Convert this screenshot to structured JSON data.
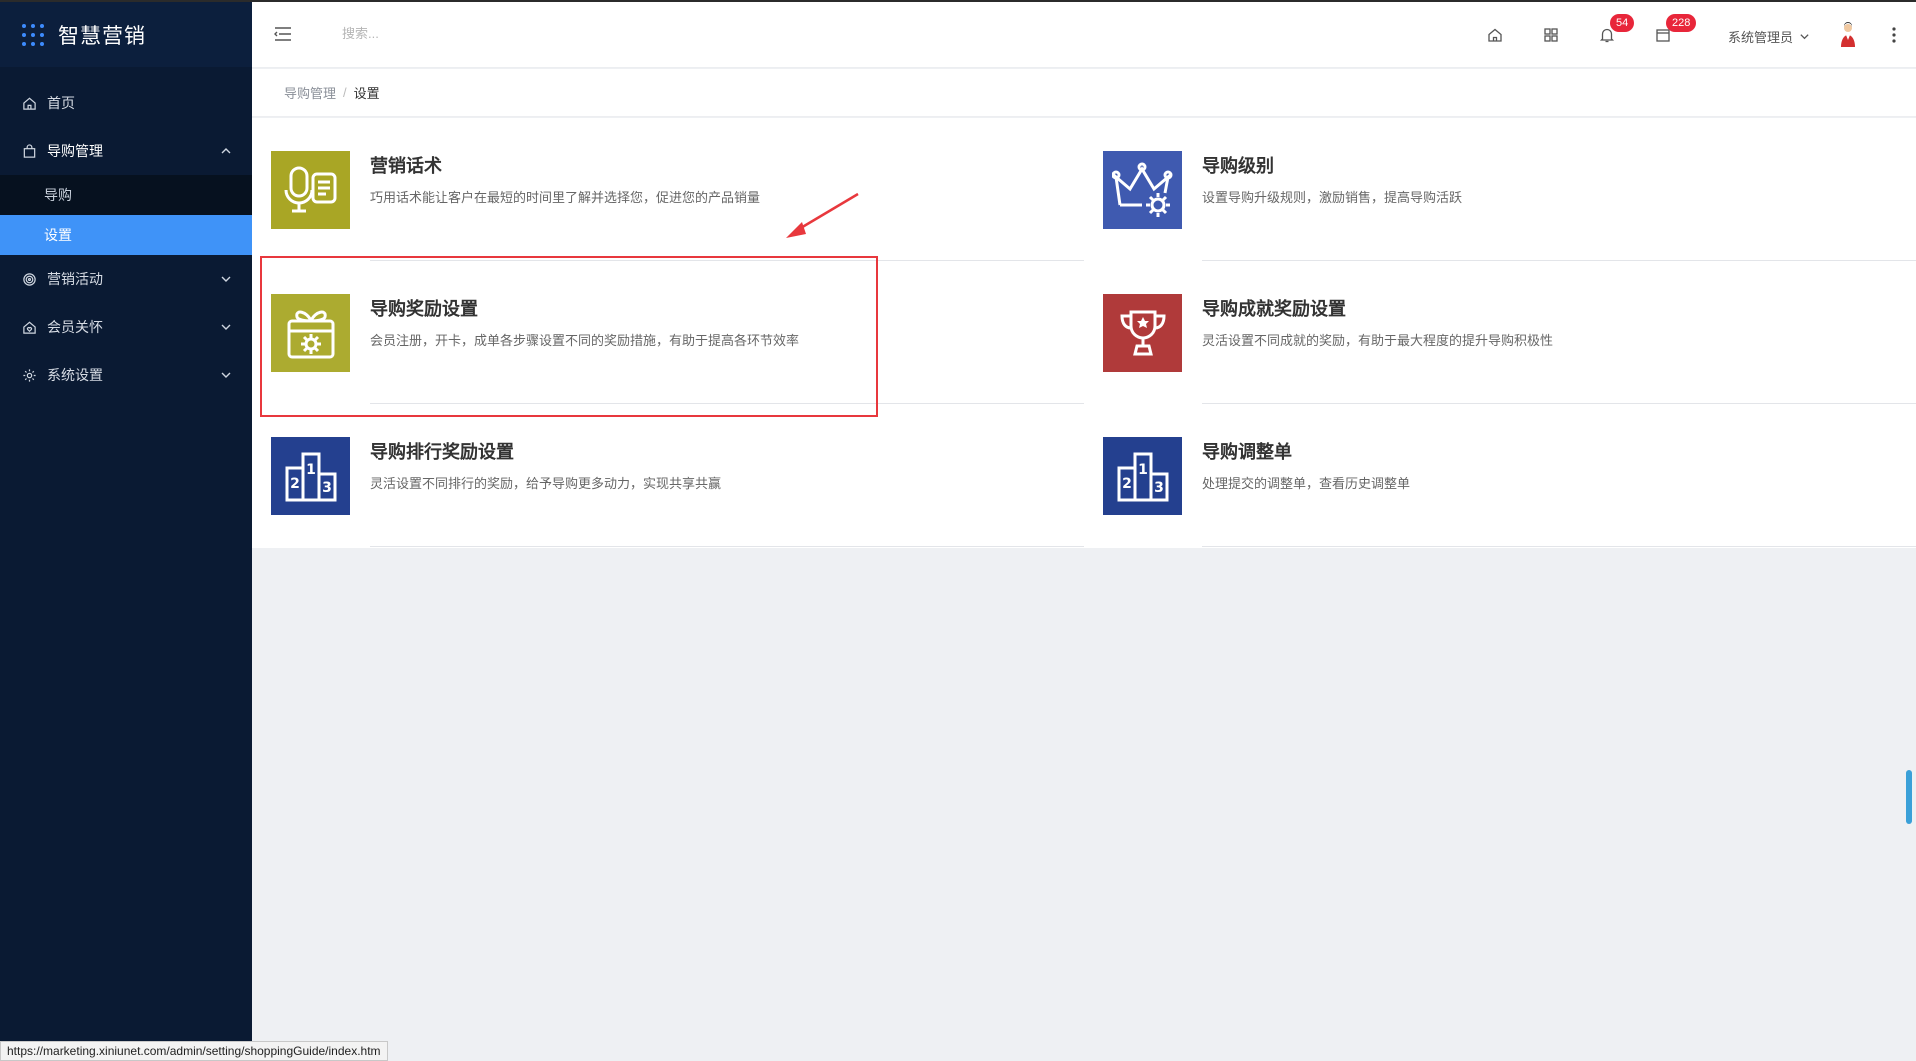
{
  "app": {
    "title": "智慧营销"
  },
  "sidebar": {
    "items": [
      {
        "label": "首页",
        "icon": "home-icon"
      },
      {
        "label": "导购管理",
        "icon": "bag-icon",
        "expanded": true,
        "children": [
          {
            "label": "导购"
          },
          {
            "label": "设置",
            "active": true
          }
        ]
      },
      {
        "label": "营销活动",
        "icon": "target-icon"
      },
      {
        "label": "会员关怀",
        "icon": "home-heart-icon"
      },
      {
        "label": "系统设置",
        "icon": "gear-icon"
      }
    ]
  },
  "header": {
    "search_placeholder": "搜索...",
    "notifications_count": "54",
    "messages_count": "228",
    "user_name": "系统管理员"
  },
  "breadcrumb": {
    "parent": "导购管理",
    "current": "设置"
  },
  "cards": [
    {
      "title": "营销话术",
      "desc": "巧用话术能让客户在最短的时间里了解并选择您，促进您的产品销量",
      "icon": "microphone-script-icon",
      "color": "#a9a625"
    },
    {
      "title": "导购级别",
      "desc": "设置导购升级规则，激励销售，提高导购活跃",
      "icon": "crown-gear-icon",
      "color": "#3f5ab0"
    },
    {
      "title": "导购奖励设置",
      "desc": "会员注册，开卡，成单各步骤设置不同的奖励措施，有助于提高各环节效率",
      "icon": "gift-gear-icon",
      "color": "#acab30"
    },
    {
      "title": "导购成就奖励设置",
      "desc": "灵活设置不同成就的奖励，有助于最大程度的提升导购积极性",
      "icon": "trophy-icon",
      "color": "#b03a3a"
    },
    {
      "title": "导购排行奖励设置",
      "desc": "灵活设置不同排行的奖励，给予导购更多动力，实现共享共赢",
      "icon": "podium-icon",
      "color": "#24408f"
    },
    {
      "title": "导购调整单",
      "desc": "处理提交的调整单，查看历史调整单",
      "icon": "podium-icon",
      "color": "#24408f"
    }
  ],
  "status_url": "https://marketing.xiniunet.com/admin/setting/shoppingGuide/index.htm",
  "colors": {
    "sidebar_bg": "#0a1a33",
    "active_blue": "#3f93f8",
    "badge_red": "#e8263a",
    "highlight_red": "#e8383d"
  }
}
